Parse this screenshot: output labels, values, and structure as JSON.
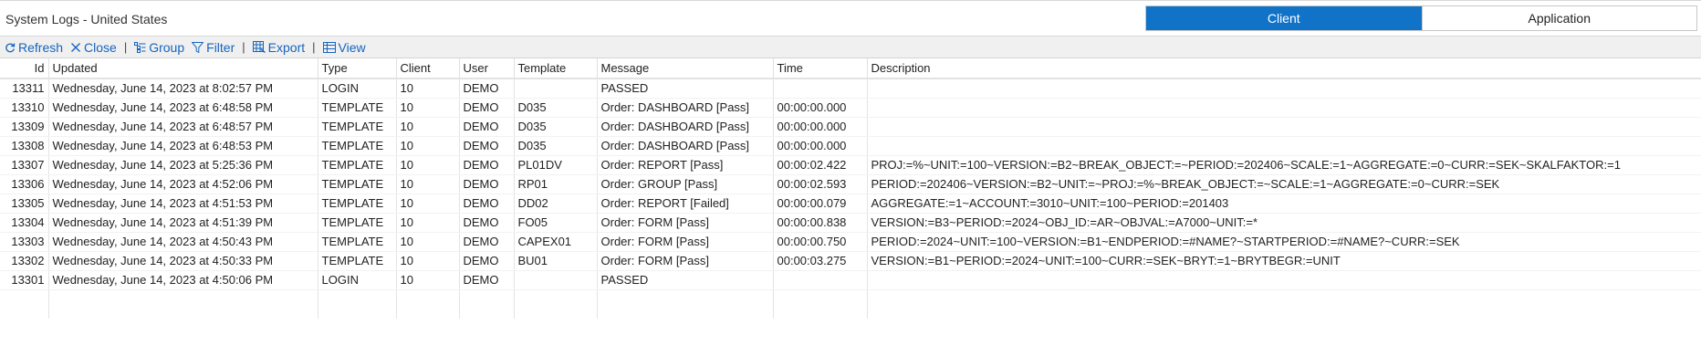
{
  "window": {
    "title": "System Logs - United States"
  },
  "segmented": {
    "client_label": "Client",
    "application_label": "Application"
  },
  "toolbar": {
    "refresh": "Refresh",
    "close": "Close",
    "group": "Group",
    "filter": "Filter",
    "export": "Export",
    "view": "View",
    "separator": "|"
  },
  "colors": {
    "accent": "#1173c7",
    "link": "#1565c0"
  },
  "table": {
    "columns": [
      "Id",
      "Updated",
      "Type",
      "Client",
      "User",
      "Template",
      "Message",
      "Time",
      "Description"
    ],
    "rows": [
      [
        "13311",
        "Wednesday, June 14, 2023 at 8:02:57 PM",
        "LOGIN",
        "10",
        "DEMO",
        "",
        "PASSED",
        "",
        ""
      ],
      [
        "13310",
        "Wednesday, June 14, 2023 at 6:48:58 PM",
        "TEMPLATE",
        "10",
        "DEMO",
        "D035",
        "Order: DASHBOARD [Pass]",
        "00:00:00.000",
        ""
      ],
      [
        "13309",
        "Wednesday, June 14, 2023 at 6:48:57 PM",
        "TEMPLATE",
        "10",
        "DEMO",
        "D035",
        "Order: DASHBOARD [Pass]",
        "00:00:00.000",
        ""
      ],
      [
        "13308",
        "Wednesday, June 14, 2023 at 6:48:53 PM",
        "TEMPLATE",
        "10",
        "DEMO",
        "D035",
        "Order: DASHBOARD [Pass]",
        "00:00:00.000",
        ""
      ],
      [
        "13307",
        "Wednesday, June 14, 2023 at 5:25:36 PM",
        "TEMPLATE",
        "10",
        "DEMO",
        "PL01DV",
        "Order: REPORT [Pass]",
        "00:00:02.422",
        "PROJ:=%~UNIT:=100~VERSION:=B2~BREAK_OBJECT:=~PERIOD:=202406~SCALE:=1~AGGREGATE:=0~CURR:=SEK~SKALFAKTOR:=1"
      ],
      [
        "13306",
        "Wednesday, June 14, 2023 at 4:52:06 PM",
        "TEMPLATE",
        "10",
        "DEMO",
        "RP01",
        "Order: GROUP [Pass]",
        "00:00:02.593",
        "PERIOD:=202406~VERSION:=B2~UNIT:=~PROJ:=%~BREAK_OBJECT:=~SCALE:=1~AGGREGATE:=0~CURR:=SEK"
      ],
      [
        "13305",
        "Wednesday, June 14, 2023 at 4:51:53 PM",
        "TEMPLATE",
        "10",
        "DEMO",
        "DD02",
        "Order: REPORT [Failed]",
        "00:00:00.079",
        "AGGREGATE:=1~ACCOUNT:=3010~UNIT:=100~PERIOD:=201403"
      ],
      [
        "13304",
        "Wednesday, June 14, 2023 at 4:51:39 PM",
        "TEMPLATE",
        "10",
        "DEMO",
        "FO05",
        "Order: FORM [Pass]",
        "00:00:00.838",
        "VERSION:=B3~PERIOD:=2024~OBJ_ID:=AR~OBJVAL:=A7000~UNIT:=*"
      ],
      [
        "13303",
        "Wednesday, June 14, 2023 at 4:50:43 PM",
        "TEMPLATE",
        "10",
        "DEMO",
        "CAPEX01",
        "Order: FORM [Pass]",
        "00:00:00.750",
        "PERIOD:=2024~UNIT:=100~VERSION:=B1~ENDPERIOD:=#NAME?~STARTPERIOD:=#NAME?~CURR:=SEK"
      ],
      [
        "13302",
        "Wednesday, June 14, 2023 at 4:50:33 PM",
        "TEMPLATE",
        "10",
        "DEMO",
        "BU01",
        "Order: FORM [Pass]",
        "00:00:03.275",
        "VERSION:=B1~PERIOD:=2024~UNIT:=100~CURR:=SEK~BRYT:=1~BRYTBEGR:=UNIT"
      ],
      [
        "13301",
        "Wednesday, June 14, 2023 at 4:50:06 PM",
        "LOGIN",
        "10",
        "DEMO",
        "",
        "PASSED",
        "",
        ""
      ]
    ]
  }
}
